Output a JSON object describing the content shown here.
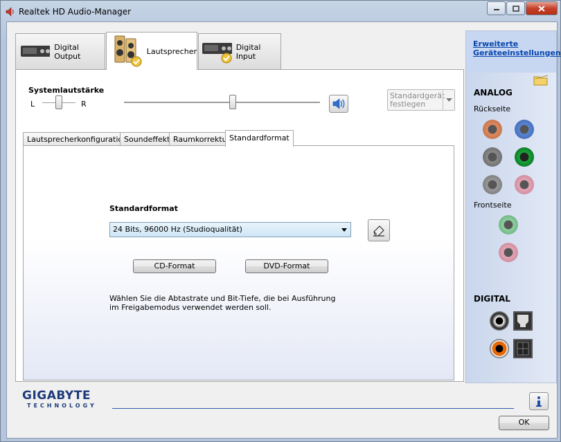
{
  "window": {
    "title": "Realtek HD Audio-Manager"
  },
  "device_tabs": [
    {
      "label": "Digital Output",
      "icon": "digital-output-device-icon"
    },
    {
      "label": "Lautsprecher",
      "icon": "speaker-device-icon",
      "active": true
    },
    {
      "label": "Digital Input",
      "icon": "digital-input-device-icon"
    }
  ],
  "volume": {
    "label": "Systemlautstärke",
    "left": "L",
    "right": "R",
    "default_device": "Standardgerät festlegen"
  },
  "inner_tabs": [
    {
      "label": "Lautsprecherkonfiguration"
    },
    {
      "label": "Soundeffekt"
    },
    {
      "label": "Raumkorrektur"
    },
    {
      "label": "Standardformat",
      "active": true
    }
  ],
  "standard_format": {
    "heading": "Standardformat",
    "selected": "24 Bits, 96000 Hz (Studioqualität)",
    "cd_button": "CD-Format",
    "dvd_button": "DVD-Format",
    "info": "Wählen Sie die Abtastrate und Bit-Tiefe, die bei Ausführung im Freigabemodus verwendet werden soll."
  },
  "right_panel": {
    "link": "Erweiterte Geräteeinstellungen",
    "analog": "ANALOG",
    "rear": "Rückseite",
    "front": "Frontseite",
    "digital": "DIGITAL",
    "colors": {
      "orange": "#e08a60",
      "blue": "#5b86d6",
      "gray": "#8a8a8a",
      "green": "#18a838",
      "pink": "#e6a6b6",
      "light_green": "#8fd0a0"
    }
  },
  "footer": {
    "brand": "GIGABYTE",
    "brand_sub": "TECHNOLOGY",
    "ok": "OK"
  }
}
